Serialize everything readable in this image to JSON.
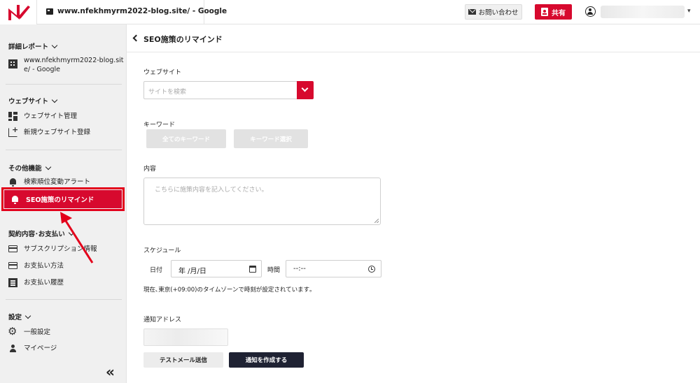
{
  "header": {
    "site_title": "www.nfekhmyrm2022-blog.site/ - Google",
    "contact_label": "お問い合わせ",
    "share_label": "共有",
    "user_name": "",
    "brand_color": "#d7092e"
  },
  "sidebar": {
    "reports_heading": "詳細レポート",
    "report_site_line1": "www.nfekhmyrm2022-blog.sit",
    "report_site_line2": "e/ - Google",
    "website_heading": "ウェブサイト",
    "website_manage": "ウェブサイト管理",
    "website_new": "新規ウェブサイト登録",
    "other_heading": "その他機能",
    "rank_alert": "検索順位変動アラート",
    "seo_remind": "SEO施策のリマインド",
    "contract_heading": "契約内容･お支払い",
    "subscription": "サブスクリプション情報",
    "payment_method": "お支払い方法",
    "payment_history": "お支払い履歴",
    "settings_heading": "設定",
    "general_settings": "一般設定",
    "my_page": "マイページ",
    "collapse_label": "«"
  },
  "main": {
    "title": "SEO施策のリマインド",
    "website_label": "ウェブサイト",
    "website_placeholder": "サイトを検索",
    "keyword_label": "キーワード",
    "all_keywords_btn": "全てのキーワード",
    "select_keywords_btn": "キーワード選択",
    "content_label": "内容",
    "content_placeholder": "こちらに施策内容を記入してください。",
    "schedule_label": "スケジュール",
    "date_label": "日付",
    "date_value": "年 /月/日",
    "time_label": "時間",
    "time_value": "--:--",
    "timezone_note": "現在､東京(+09:00)のタイムゾーンで時刻が設定されています｡",
    "address_label": "通知アドレス",
    "address_value": "",
    "test_mail_btn": "テストメール送信",
    "create_btn": "通知を作成する"
  }
}
